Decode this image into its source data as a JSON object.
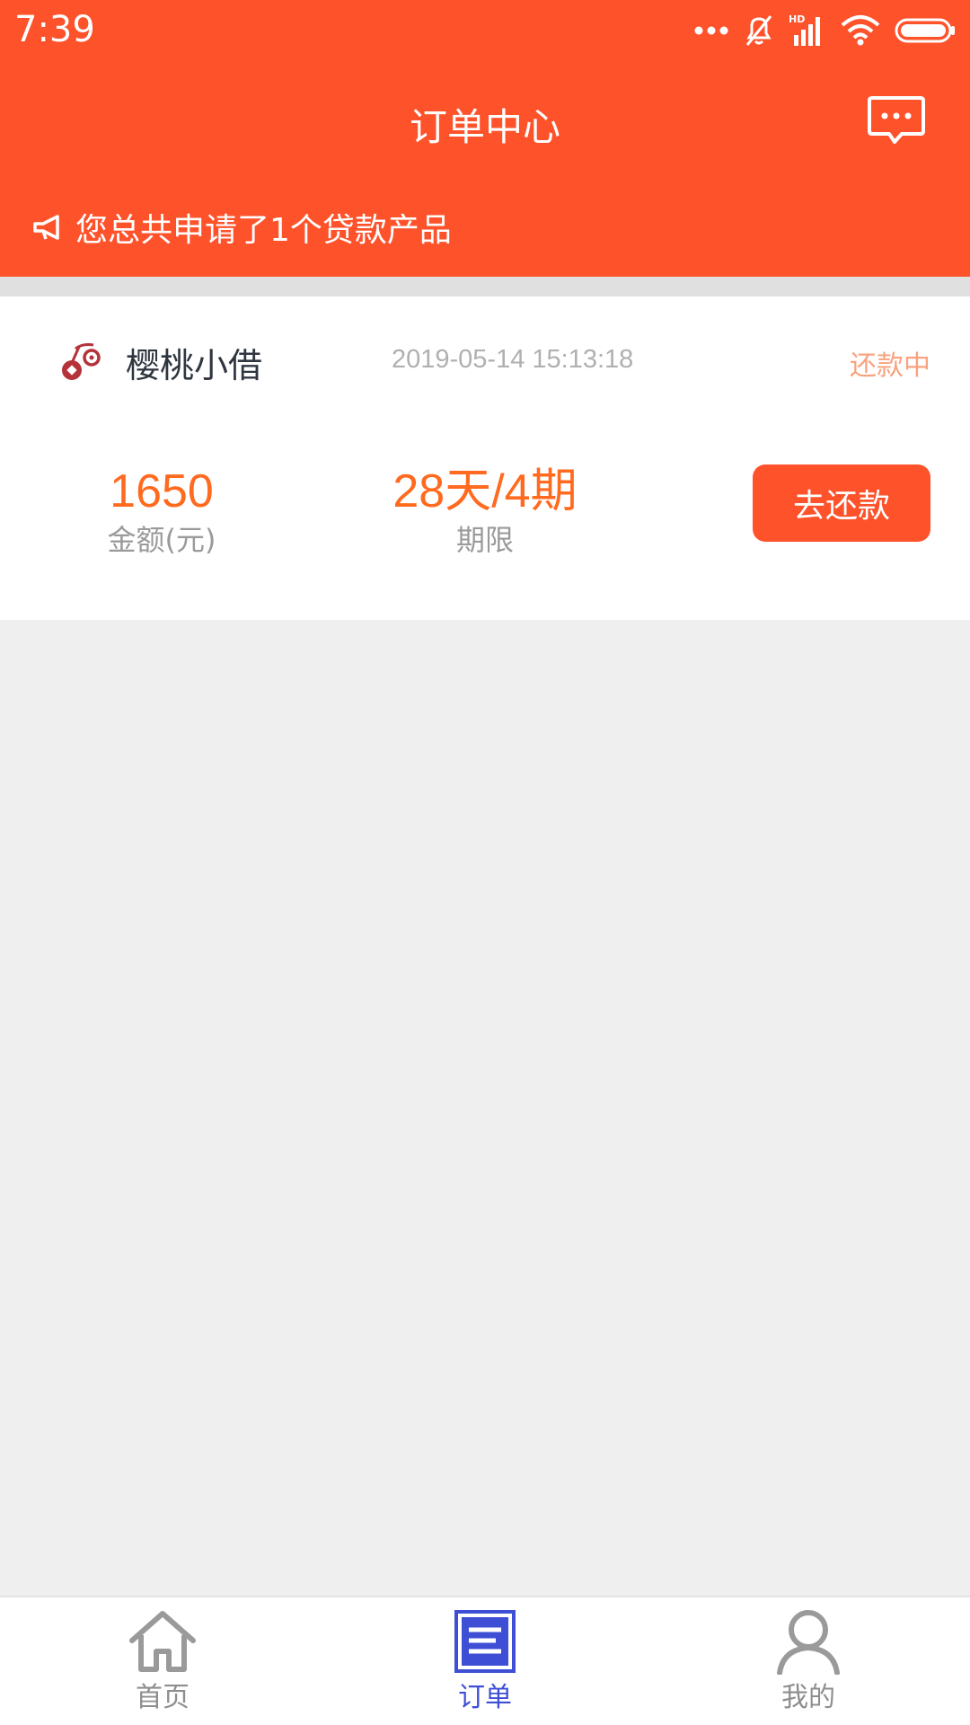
{
  "status_bar": {
    "time": "7:39"
  },
  "header": {
    "title": "订单中心",
    "notice": "您总共申请了1个贷款产品"
  },
  "order": {
    "product_name": "樱桃小借",
    "datetime": "2019-05-14 15:13:18",
    "status": "还款中",
    "amount": "1650",
    "amount_label": "金额(元)",
    "term": "28天/4期",
    "term_label": "期限",
    "action_label": "去还款"
  },
  "tabs": [
    {
      "label": "首页",
      "icon": "home-icon",
      "active": false
    },
    {
      "label": "订单",
      "icon": "order-icon",
      "active": true
    },
    {
      "label": "我的",
      "icon": "profile-icon",
      "active": false
    }
  ],
  "colors": {
    "brand": "#fe522b",
    "accent_value": "#ff6a1f",
    "status_text": "#f9a27e",
    "tab_active": "#3e4fd6",
    "tab_inactive": "#8e8e8e",
    "background": "#efefef"
  }
}
